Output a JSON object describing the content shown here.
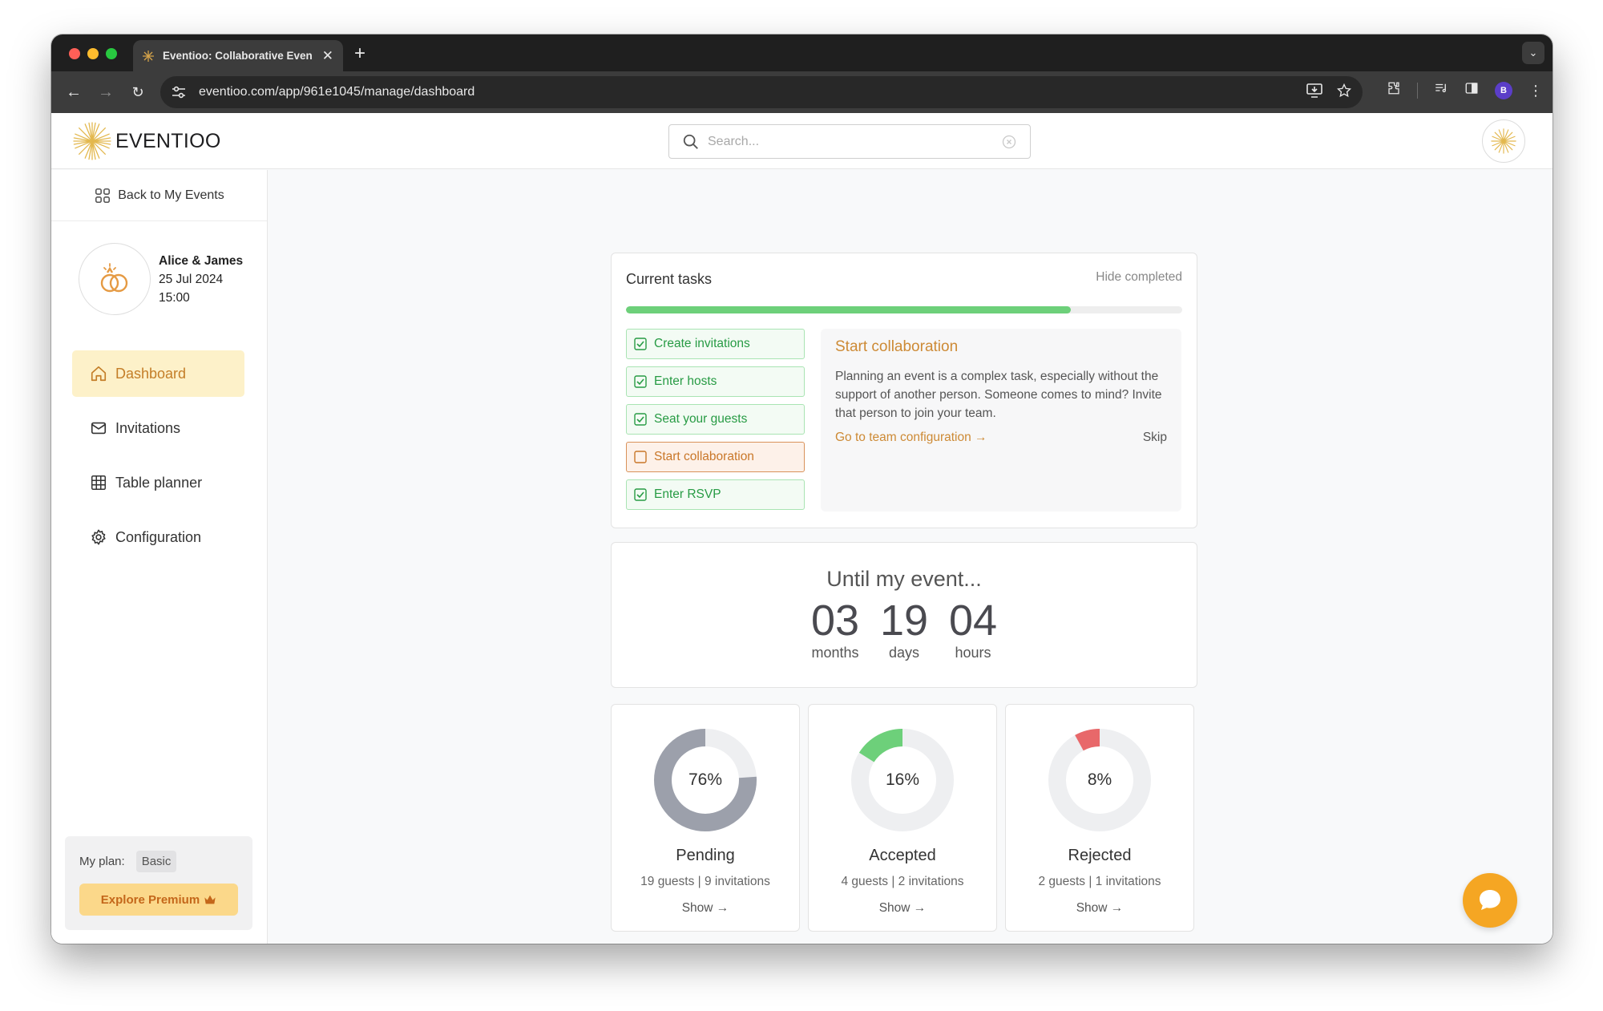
{
  "browser": {
    "tab_title": "Eventioo: Collaborative Even",
    "new_tab": "+",
    "url": "eventioo.com/app/961e1045/manage/dashboard",
    "profile_initial": "B"
  },
  "header": {
    "logo_text": "EVENTIOO",
    "search_placeholder": "Search..."
  },
  "sidebar": {
    "back_label": "Back to My Events",
    "event": {
      "name": "Alice & James",
      "date": "25 Jul 2024",
      "time": "15:00"
    },
    "nav": [
      {
        "label": "Dashboard",
        "icon": "home-icon",
        "active": true
      },
      {
        "label": "Invitations",
        "icon": "mail-icon",
        "active": false
      },
      {
        "label": "Table planner",
        "icon": "grid-icon",
        "active": false
      },
      {
        "label": "Configuration",
        "icon": "gear-icon",
        "active": false
      }
    ],
    "plan": {
      "label": "My plan:",
      "value": "Basic",
      "cta": "Explore Premium"
    }
  },
  "tasks": {
    "title": "Current tasks",
    "hide_completed": "Hide completed",
    "progress_percent": 80,
    "items": [
      {
        "label": "Create invitations",
        "done": true
      },
      {
        "label": "Enter hosts",
        "done": true
      },
      {
        "label": "Seat your guests",
        "done": true
      },
      {
        "label": "Start collaboration",
        "done": false
      },
      {
        "label": "Enter RSVP",
        "done": true
      }
    ],
    "detail": {
      "title": "Start collaboration",
      "text": "Planning an event is a complex task, especially without the support of another person. Someone comes to mind? Invite that person to join your team.",
      "link": "Go to team configuration →",
      "skip": "Skip"
    }
  },
  "countdown": {
    "title": "Until my event...",
    "months": {
      "value": "03",
      "label": "months"
    },
    "days": {
      "value": "19",
      "label": "days"
    },
    "hours": {
      "value": "04",
      "label": "hours"
    }
  },
  "stats": [
    {
      "label": "Pending",
      "percent": 76,
      "percent_text": "76%",
      "sub": "19 guests | 9 invitations",
      "show": "Show →",
      "color": "#9ca0ab"
    },
    {
      "label": "Accepted",
      "percent": 16,
      "percent_text": "16%",
      "sub": "4 guests | 2 invitations",
      "show": "Show →",
      "color": "#6dd07a"
    },
    {
      "label": "Rejected",
      "percent": 8,
      "percent_text": "8%",
      "sub": "2 guests | 1 invitations",
      "show": "Show →",
      "color": "#e8686a"
    }
  ],
  "colors": {
    "accent": "#cd8a35",
    "success": "#279b44",
    "progress": "#6dd07a",
    "chat": "#f5a623"
  }
}
